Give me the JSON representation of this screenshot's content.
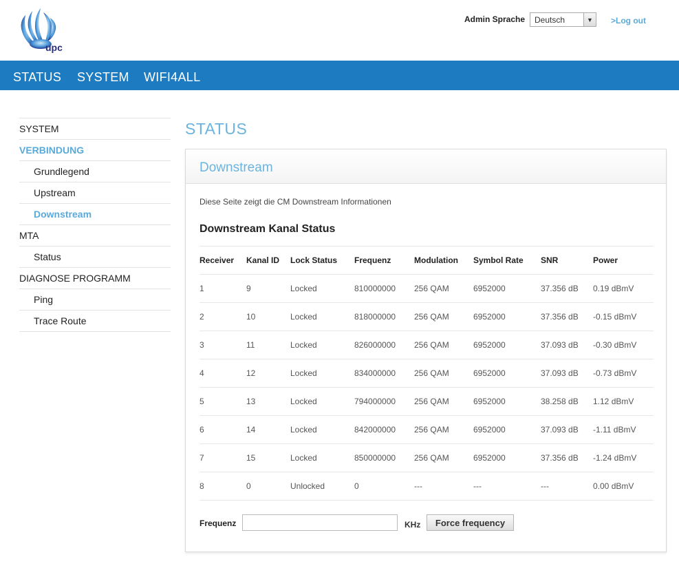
{
  "header": {
    "logo_text": "upc",
    "lang_label": "Admin Sprache",
    "lang_selected": "Deutsch",
    "logout": ">Log out"
  },
  "topnav": [
    "STATUS",
    "SYSTEM",
    "WIFI4ALL"
  ],
  "sidebar": [
    {
      "label": "SYSTEM"
    },
    {
      "label": "VERBINDUNG"
    },
    {
      "label": "Grundlegend"
    },
    {
      "label": "Upstream"
    },
    {
      "label": "Downstream"
    },
    {
      "label": "MTA"
    },
    {
      "label": "Status"
    },
    {
      "label": "DIAGNOSE PROGRAMM"
    },
    {
      "label": "Ping"
    },
    {
      "label": "Trace Route"
    }
  ],
  "main": {
    "page_title": "STATUS",
    "panel_title": "Downstream",
    "description": "Diese Seite zeigt die CM Downstream Informationen",
    "section_title": "Downstream Kanal Status",
    "columns": [
      "Receiver",
      "Kanal ID",
      "Lock Status",
      "Frequenz",
      "Modulation",
      "Symbol Rate",
      "SNR",
      "Power"
    ],
    "rows": [
      [
        "1",
        "9",
        "Locked",
        "810000000",
        "256 QAM",
        "6952000",
        "37.356 dB",
        "0.19 dBmV"
      ],
      [
        "2",
        "10",
        "Locked",
        "818000000",
        "256 QAM",
        "6952000",
        "37.356 dB",
        "-0.15 dBmV"
      ],
      [
        "3",
        "11",
        "Locked",
        "826000000",
        "256 QAM",
        "6952000",
        "37.093 dB",
        "-0.30 dBmV"
      ],
      [
        "4",
        "12",
        "Locked",
        "834000000",
        "256 QAM",
        "6952000",
        "37.093 dB",
        "-0.73 dBmV"
      ],
      [
        "5",
        "13",
        "Locked",
        "794000000",
        "256 QAM",
        "6952000",
        "38.258 dB",
        "1.12 dBmV"
      ],
      [
        "6",
        "14",
        "Locked",
        "842000000",
        "256 QAM",
        "6952000",
        "37.093 dB",
        "-1.11 dBmV"
      ],
      [
        "7",
        "15",
        "Locked",
        "850000000",
        "256 QAM",
        "6952000",
        "37.356 dB",
        "-1.24 dBmV"
      ],
      [
        "8",
        "0",
        "Unlocked",
        "0",
        "---",
        "---",
        "---",
        "0.00 dBmV"
      ]
    ],
    "freq_label": "Frequenz",
    "freq_value": "",
    "khz_label": "KHz",
    "force_button": "Force frequency"
  }
}
